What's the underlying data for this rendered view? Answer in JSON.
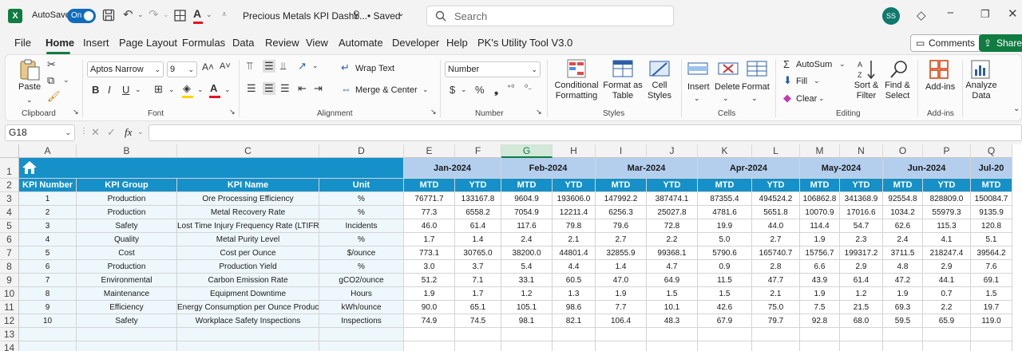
{
  "titlebar": {
    "app_icon": "X",
    "autosave_label": "AutoSave",
    "autosave_state": "On",
    "file_title": "Precious Metals KPI Dashb...",
    "saved_label": "• Saved",
    "search_placeholder": "Search",
    "avatar_initials": "SS"
  },
  "menu": {
    "items": [
      "File",
      "Home",
      "Insert",
      "Page Layout",
      "Formulas",
      "Data",
      "Review",
      "View",
      "Automate",
      "Developer",
      "Help",
      "PK's Utility Tool V3.0"
    ],
    "active": "Home",
    "comments_label": "Comments",
    "share_label": "Share"
  },
  "ribbon": {
    "paste_label": "Paste",
    "font_name": "Aptos Narrow",
    "font_size": "9",
    "wrap_text": "Wrap Text",
    "merge_center": "Merge & Center",
    "number_format": "Number",
    "conditional_formatting": "Conditional Formatting",
    "format_as_table": "Format as Table",
    "cell_styles": "Cell Styles",
    "insert": "Insert",
    "delete": "Delete",
    "format": "Format",
    "autosum": "AutoSum",
    "fill": "Fill",
    "clear": "Clear",
    "sort_filter": "Sort & Filter",
    "find_select": "Find & Select",
    "add_ins": "Add-ins",
    "analyze_data": "Analyze Data",
    "groups": {
      "clipboard": "Clipboard",
      "font": "Font",
      "alignment": "Alignment",
      "number": "Number",
      "styles": "Styles",
      "cells": "Cells",
      "editing": "Editing",
      "add_ins": "Add-ins"
    },
    "colors": {
      "fill_swatch": "#ffd400",
      "font_swatch": "#e81123"
    }
  },
  "formula_bar": {
    "name_box": "G18",
    "fx_label": "fx",
    "content": ""
  },
  "sheet": {
    "columns": [
      "A",
      "B",
      "C",
      "D",
      "E",
      "F",
      "G",
      "H",
      "I",
      "J",
      "K",
      "L",
      "M",
      "N",
      "O",
      "P",
      "Q"
    ],
    "selected_column": "G",
    "rows": [
      "1",
      "2",
      "3",
      "4",
      "5",
      "6",
      "7",
      "8",
      "9",
      "10",
      "11",
      "12",
      "13",
      "14"
    ],
    "headers": [
      "KPI Number",
      "KPI Group",
      "KPI Name",
      "Unit"
    ],
    "months": [
      "Jan-2024",
      "Feb-2024",
      "Mar-2024",
      "Apr-2024",
      "May-2024",
      "Jun-2024",
      "Jul-20"
    ],
    "mtd_label": "MTD",
    "ytd_label": "YTD",
    "colors": {
      "header_blue": "#1690c8",
      "month_band": "#b4cfee",
      "row_light": "#eef7fc"
    },
    "kpis": [
      {
        "num": "1",
        "group": "Production",
        "name": "Ore Processing Efficiency",
        "unit": "%",
        "values": [
          "76771.7",
          "133167.8",
          "9604.9",
          "193606.0",
          "147992.2",
          "387474.1",
          "87355.4",
          "494524.2",
          "106862.8",
          "341368.9",
          "92554.8",
          "828809.0",
          "150084.7"
        ]
      },
      {
        "num": "2",
        "group": "Production",
        "name": "Metal Recovery Rate",
        "unit": "%",
        "values": [
          "77.3",
          "6558.2",
          "7054.9",
          "12211.4",
          "6256.3",
          "25027.8",
          "4781.6",
          "5651.8",
          "10070.9",
          "17016.6",
          "1034.2",
          "55979.3",
          "9135.9"
        ]
      },
      {
        "num": "3",
        "group": "Safety",
        "name": "Lost Time Injury Frequency Rate (LTIFR)",
        "unit": "Incidents",
        "values": [
          "46.0",
          "61.4",
          "117.6",
          "79.8",
          "79.6",
          "72.8",
          "19.9",
          "44.0",
          "114.4",
          "54.7",
          "62.6",
          "115.3",
          "120.8"
        ]
      },
      {
        "num": "4",
        "group": "Quality",
        "name": "Metal Purity Level",
        "unit": "%",
        "values": [
          "1.7",
          "1.4",
          "2.4",
          "2.1",
          "2.7",
          "2.2",
          "5.0",
          "2.7",
          "1.9",
          "2.3",
          "2.4",
          "4.1",
          "5.1"
        ]
      },
      {
        "num": "5",
        "group": "Cost",
        "name": "Cost per Ounce",
        "unit": "$/ounce",
        "values": [
          "773.1",
          "30765.0",
          "38200.0",
          "44801.4",
          "32855.9",
          "99368.1",
          "5790.6",
          "165740.7",
          "15756.7",
          "199317.2",
          "3711.5",
          "218247.4",
          "39564.2"
        ]
      },
      {
        "num": "6",
        "group": "Production",
        "name": "Production Yield",
        "unit": "%",
        "values": [
          "3.0",
          "3.7",
          "5.4",
          "4.4",
          "1.4",
          "4.7",
          "0.9",
          "2.8",
          "6.6",
          "2.9",
          "4.8",
          "2.9",
          "7.6"
        ]
      },
      {
        "num": "7",
        "group": "Environmental",
        "name": "Carbon Emission Rate",
        "unit": "gCO2/ounce",
        "values": [
          "51.2",
          "7.1",
          "33.1",
          "60.5",
          "47.0",
          "64.9",
          "11.5",
          "47.7",
          "43.9",
          "61.4",
          "47.2",
          "44.1",
          "69.1"
        ]
      },
      {
        "num": "8",
        "group": "Maintenance",
        "name": "Equipment Downtime",
        "unit": "Hours",
        "values": [
          "1.9",
          "1.7",
          "1.2",
          "1.3",
          "1.9",
          "1.5",
          "1.5",
          "2.1",
          "1.9",
          "1.2",
          "1.9",
          "0.7",
          "1.5"
        ]
      },
      {
        "num": "9",
        "group": "Efficiency",
        "name": "Energy Consumption per Ounce Produced",
        "unit": "kWh/ounce",
        "values": [
          "90.0",
          "65.1",
          "105.1",
          "98.6",
          "7.7",
          "10.1",
          "42.6",
          "75.0",
          "7.5",
          "21.5",
          "69.3",
          "2.2",
          "19.7"
        ]
      },
      {
        "num": "10",
        "group": "Safety",
        "name": "Workplace Safety Inspections",
        "unit": "Inspections",
        "values": [
          "74.9",
          "74.5",
          "98.1",
          "82.1",
          "106.4",
          "48.3",
          "67.9",
          "79.7",
          "92.8",
          "68.0",
          "59.5",
          "65.9",
          "119.0"
        ]
      }
    ]
  }
}
